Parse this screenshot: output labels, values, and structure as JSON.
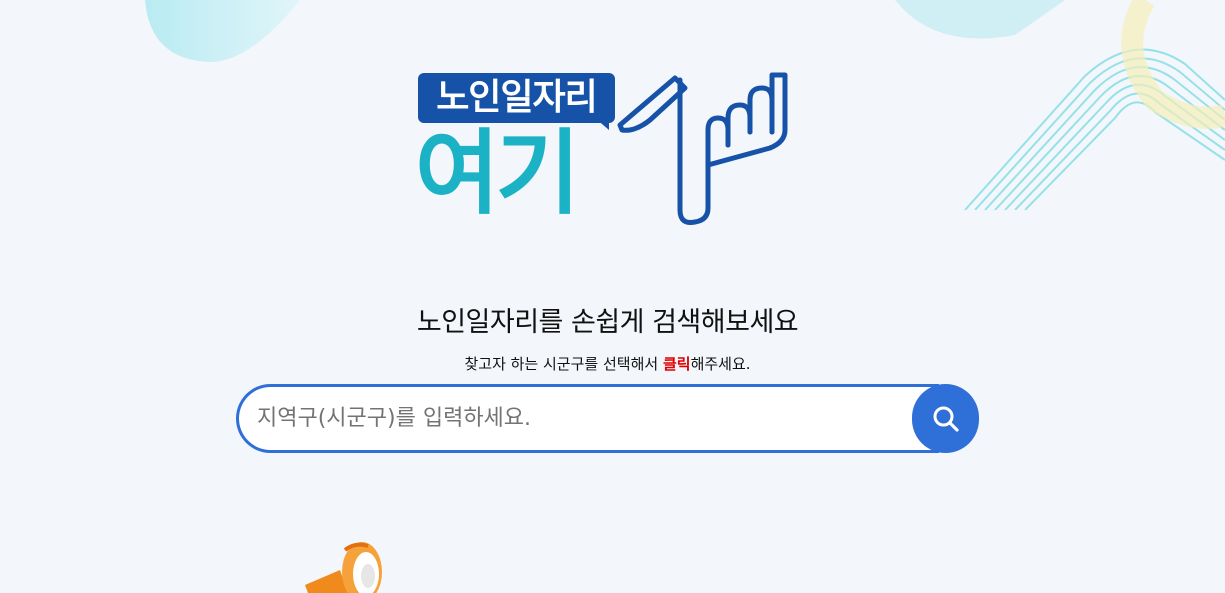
{
  "logo": {
    "badge_text": "노인일자리",
    "main_text": "여기"
  },
  "hero": {
    "headline": "노인일자리를 손쉽게 검색해보세요",
    "subline_before": "찾고자 하는 시군구를 선택해서 ",
    "subline_highlight": "클릭",
    "subline_after": "해주세요."
  },
  "search": {
    "placeholder": "지역구(시군구)를 입력하세요.",
    "value": ""
  },
  "colors": {
    "background": "#f3f6fa",
    "accent_blue": "#2f6fd8",
    "logo_navy": "#1652a8",
    "logo_teal": "#1bb2c6",
    "highlight_red": "#e00000"
  },
  "icons": {
    "search_button": "search-icon",
    "logo_mark": "pointing-hand-icon",
    "decor_bottom": "megaphone-icon"
  }
}
